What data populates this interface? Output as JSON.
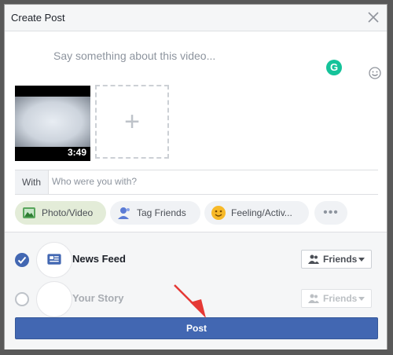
{
  "dialog": {
    "title": "Create Post"
  },
  "composer": {
    "placeholder": "Say something about this video..."
  },
  "media": {
    "video_duration": "3:49",
    "add_icon": "plus-icon"
  },
  "with": {
    "label": "With",
    "placeholder": "Who were you with?"
  },
  "actions": [
    {
      "label": "Photo/Video",
      "icon": "photo-video-icon",
      "active": true
    },
    {
      "label": "Tag Friends",
      "icon": "tag-friends-icon",
      "active": false
    },
    {
      "label": "Feeling/Activ...",
      "icon": "feeling-emoji-icon",
      "active": false
    },
    {
      "label": "•••",
      "icon": "more-icon",
      "active": false
    }
  ],
  "share_targets": [
    {
      "name": "News Feed",
      "selected": true,
      "audience": "Friends",
      "enabled": true
    },
    {
      "name": "Your Story",
      "selected": false,
      "audience": "Friends",
      "enabled": false
    }
  ],
  "post_button": {
    "label": "Post"
  },
  "colors": {
    "primary": "#4267b2",
    "grammarly": "#15c39a",
    "arrow": "#e53935",
    "active_pill": "#e3ecd8"
  }
}
